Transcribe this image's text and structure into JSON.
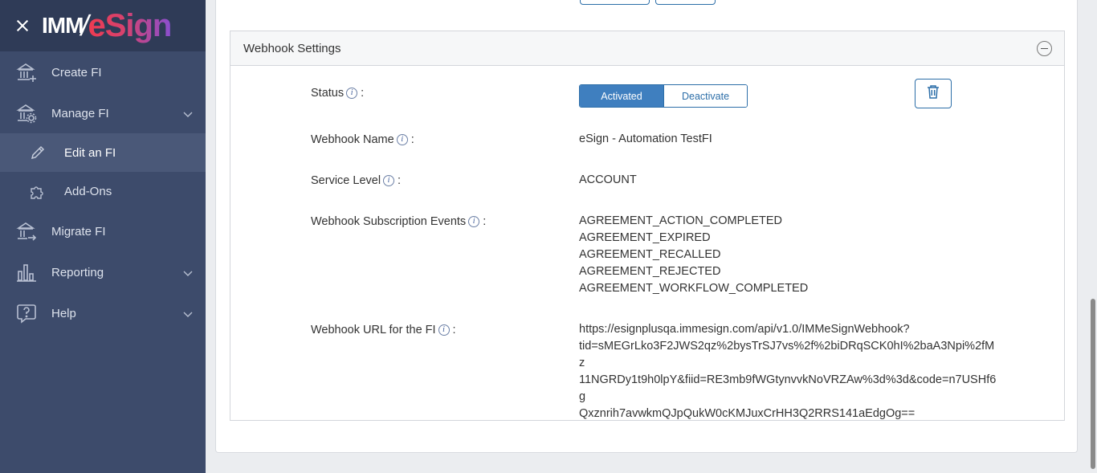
{
  "app": {
    "logo_imm": "IMM",
    "logo_esign": "eSign"
  },
  "sidebar": {
    "items": [
      {
        "label": "Create FI",
        "icon": "bank-plus-icon"
      },
      {
        "label": "Manage FI",
        "icon": "bank-gear-icon",
        "expandable": true
      },
      {
        "label": "Edit an FI",
        "icon": "pencil-icon",
        "active": true
      },
      {
        "label": "Add-Ons",
        "icon": "puzzle-icon"
      },
      {
        "label": "Migrate FI",
        "icon": "bank-arrow-icon"
      },
      {
        "label": "Reporting",
        "icon": "bar-chart-icon",
        "expandable": true
      },
      {
        "label": "Help",
        "icon": "help-icon",
        "expandable": true
      }
    ]
  },
  "webhook": {
    "panel_title": "Webhook Settings",
    "status_label": "Status",
    "status_on": "Activated",
    "status_off": "Deactivate",
    "name_label": "Webhook Name",
    "name_value": "eSign - Automation TestFI",
    "service_label": "Service Level",
    "service_value": "ACCOUNT",
    "events_label": "Webhook Subscription Events",
    "events": [
      "AGREEMENT_ACTION_COMPLETED",
      "AGREEMENT_EXPIRED",
      "AGREEMENT_RECALLED",
      "AGREEMENT_REJECTED",
      "AGREEMENT_WORKFLOW_COMPLETED"
    ],
    "url_label": "Webhook URL for the FI",
    "url_lines": [
      "https://esignplusqa.immesign.com/api/v1.0/IMMeSignWebhook?",
      "tid=sMEGrLko3F2JWS2qz%2bysTrSJ7vs%2f%2biDRqSCK0hI%2baA3Npi%2fMz",
      "11NGRDy1t9h0lpY&fiid=RE3mb9fWGtynvvkNoVRZAw%3d%3d&code=n7USHf6g",
      "Qxznrih7avwkmQJpQukW0cKMJuxCrHH3Q2RRS141aEdgOg=="
    ],
    "colon": ":",
    "info_glyph": "i"
  },
  "colors": {
    "accent": "#2c6ea8",
    "sidebar_bg": "#3d4b6b",
    "sidebar_header": "#2f3b57"
  }
}
